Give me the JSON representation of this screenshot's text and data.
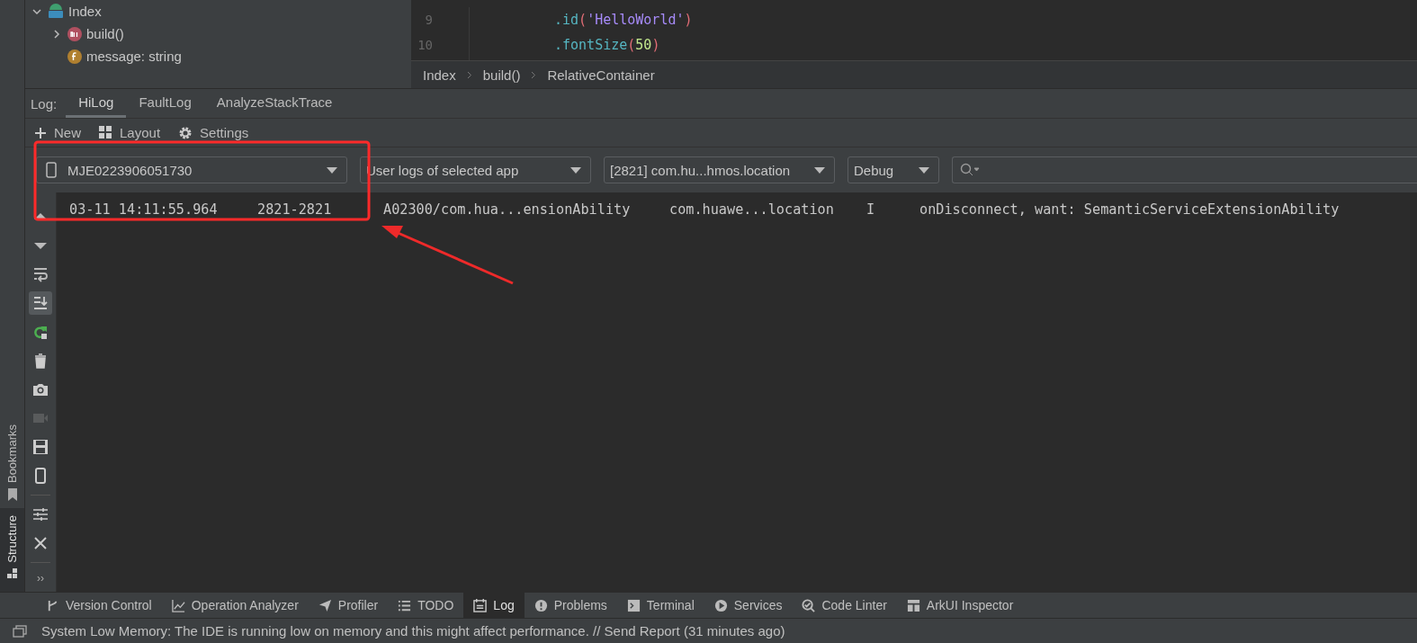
{
  "left_strip": {
    "tabs": [
      {
        "label": "Bookmarks",
        "kind": "bookmark",
        "selected": false
      },
      {
        "label": "Structure",
        "kind": "structure",
        "selected": true
      }
    ]
  },
  "structure_tree": [
    {
      "label": "Index",
      "kind": "file",
      "expanded": true,
      "children": [
        {
          "label": "build()",
          "kind": "method",
          "expanded": false
        },
        {
          "label": "message: string",
          "kind": "field"
        }
      ]
    }
  ],
  "editor": {
    "lines": [
      {
        "number": "9",
        "tokens": [
          {
            "text": ".id",
            "kind": "method"
          },
          {
            "text": "(",
            "kind": "paren"
          },
          {
            "text": "'HelloWorld'",
            "kind": "string"
          },
          {
            "text": ")",
            "kind": "paren"
          }
        ]
      },
      {
        "number": "10",
        "tokens": [
          {
            "text": ".fontSize",
            "kind": "method"
          },
          {
            "text": "(",
            "kind": "paren"
          },
          {
            "text": "50",
            "kind": "number"
          },
          {
            "text": ")",
            "kind": "paren"
          }
        ]
      }
    ],
    "breadcrumb": [
      "Index",
      "build()",
      "RelativeContainer"
    ]
  },
  "log_panel": {
    "label": "Log:",
    "tabs": [
      {
        "label": "HiLog",
        "selected": true
      },
      {
        "label": "FaultLog",
        "selected": false
      },
      {
        "label": "AnalyzeStackTrace",
        "selected": false
      }
    ],
    "toolbar": [
      {
        "label": "New",
        "kind": "plus"
      },
      {
        "label": "Layout",
        "kind": "grid"
      },
      {
        "label": "Settings",
        "kind": "gear"
      }
    ],
    "filters": [
      {
        "kind": "device",
        "value": "MJE0223906051730"
      },
      {
        "kind": "plain",
        "value": "User logs of selected app"
      },
      {
        "kind": "plain",
        "value": "[2821] com.hu...hmos.location"
      },
      {
        "kind": "plain",
        "value": "Debug"
      }
    ],
    "search": {
      "kind": "search"
    },
    "side_tools": [
      {
        "kind": "up",
        "selected": false,
        "disabled": false
      },
      {
        "kind": "down",
        "selected": false,
        "disabled": false
      },
      {
        "kind": "wrap",
        "selected": false,
        "disabled": false
      },
      {
        "kind": "scroll-end",
        "selected": true,
        "disabled": false
      },
      {
        "kind": "restart",
        "selected": false,
        "disabled": false
      },
      {
        "kind": "trash",
        "selected": false,
        "disabled": false
      },
      {
        "kind": "camera",
        "selected": false,
        "disabled": false
      },
      {
        "kind": "video",
        "selected": false,
        "disabled": true
      },
      {
        "kind": "save",
        "selected": false,
        "disabled": false
      },
      {
        "kind": "phone",
        "selected": false,
        "disabled": false
      },
      {
        "kind": "sliders",
        "selected": false,
        "disabled": false
      },
      {
        "kind": "close",
        "selected": false,
        "disabled": false
      }
    ],
    "more": "››",
    "rows": [
      {
        "time": "03-11 14:11:55.964",
        "pid": "2821-2821",
        "tag": "A02300/com.hua...ensionAbility",
        "package": "com.huawe...location",
        "level": "I",
        "message": "onDisconnect, want: SemanticServiceExtensionAbility"
      }
    ]
  },
  "tool_windows": [
    {
      "label": "Version Control",
      "kind": "vcs",
      "selected": false
    },
    {
      "label": "Operation Analyzer",
      "kind": "chart",
      "selected": false
    },
    {
      "label": "Profiler",
      "kind": "plane",
      "selected": false
    },
    {
      "label": "TODO",
      "kind": "list",
      "selected": false
    },
    {
      "label": "Log",
      "kind": "log",
      "selected": true
    },
    {
      "label": "Problems",
      "kind": "alert",
      "selected": false
    },
    {
      "label": "Terminal",
      "kind": "terminal",
      "selected": false
    },
    {
      "label": "Services",
      "kind": "play",
      "selected": false
    },
    {
      "label": "Code Linter",
      "kind": "lint",
      "selected": false
    },
    {
      "label": "ArkUI Inspector",
      "kind": "inspector",
      "selected": false
    }
  ],
  "status_bar": {
    "message": "System Low Memory: The IDE is running low on memory and this might affect performance. // Send Report (31 minutes ago)"
  }
}
